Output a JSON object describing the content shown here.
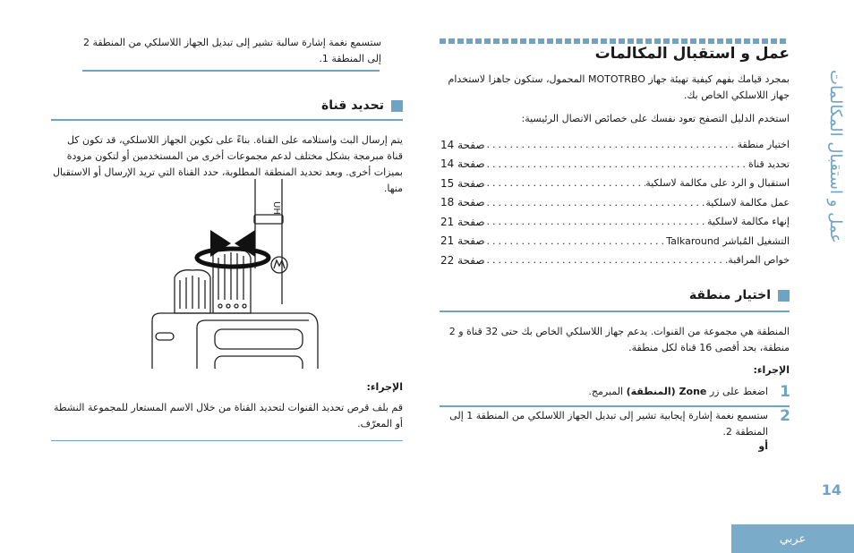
{
  "side_tab": {
    "label": "عمل و استقبال المكالمات"
  },
  "page": {
    "number": "14",
    "language_tab": "عربي"
  },
  "colors": {
    "accent": "#6fa3c4",
    "lang_tab_bg": "#7aabc9"
  },
  "right_column": {
    "title": "عمل و استقبال المكالمات",
    "intro": "بمجرد قيامك بفهم كيفية تهيئة جهاز MOTOTRBO المحمول، ستكون جاهزا لاستخدام جهاز اللاسلكي الخاص بك.",
    "toc_lead": "استخدم الدليل التصفح تعود نفسك على خصائص الاتصال الرئيسية:",
    "toc": [
      {
        "label": "اختيار منطقة",
        "page": "صفحة 14"
      },
      {
        "label": "تحديد قناة",
        "page": "صفحة 14"
      },
      {
        "label": "استقبال و الرد على مكالمة لاسلكية",
        "page": "صفحة 15"
      },
      {
        "label": "عمل مكالمة لاسلكية",
        "page": "صفحة 18"
      },
      {
        "label": "إنهاء مكالمة لاسلكية",
        "page": "صفحة 21"
      },
      {
        "label": "التشغيل المُباشر Talkaround",
        "page": "صفحة 21"
      },
      {
        "label": "خواص المراقبة",
        "page": "صفحة 22"
      }
    ],
    "zone_section": {
      "heading": "اختيار منطقة",
      "body": "المنطقة هي مجموعة من القنوات. يدعم جهاز اللاسلكي الخاص بك حتى 32 قناة و 2 منطقة، بحد أقصى 16 قناة لكل منطقة.",
      "procedure_label": "الإجراء:",
      "steps": [
        {
          "number": "1",
          "text_before": "اضغط على زر ",
          "bold": "Zone (المنطقة)",
          "text_after": " المبرمج."
        },
        {
          "number": "2",
          "text": "ستسمع نغمة إشارة إيجابية تشير إلى تبديل الجهاز اللاسلكي من المنطقة 1 إلى المنطقة 2.",
          "or": "أو"
        }
      ]
    }
  },
  "left_column": {
    "continued_text": "ستسمع نغمة إشارة سالبة تشير إلى تبديل الجهاز اللاسلكي من المنطقة 2 إلى المنطقة 1.",
    "channel_section": {
      "heading": "تحديد قناة",
      "body": "يتم إرسال البث واستلامه على القناة. بناءً على تكوين الجهاز اللاسلكي، قد تكون كل قناة مبرمجة بشكل مختلف لدعم مجموعات أخرى من المستخدمين أو لتكون مزودة بميزات أخرى. وبعد تحديد المنطقة المطلوبة، حدد القناة التي تريد الإرسال أو الاستقبال منها.",
      "illustration": "radio-channel-knob-rotation",
      "procedure_label": "الإجراء:",
      "procedure_text": "قم بلف قرص تحديد القنوات لتحديد القناة من خلال الاسم المستعار للمجموعة النشطة أو المعرّف."
    }
  }
}
